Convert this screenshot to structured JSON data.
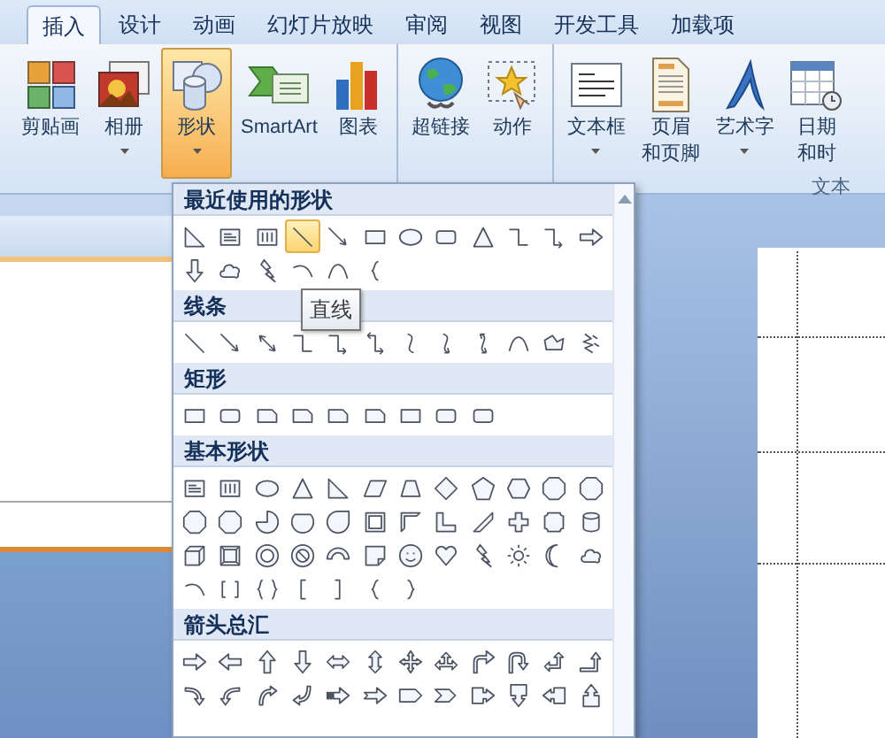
{
  "ribbon_tabs": [
    {
      "label": "插入",
      "selected": true
    },
    {
      "label": "设计",
      "selected": false
    },
    {
      "label": "动画",
      "selected": false
    },
    {
      "label": "幻灯片放映",
      "selected": false
    },
    {
      "label": "审阅",
      "selected": false
    },
    {
      "label": "视图",
      "selected": false
    },
    {
      "label": "开发工具",
      "selected": false
    },
    {
      "label": "加载项",
      "selected": false
    }
  ],
  "ribbon_groups": [
    {
      "buttons": [
        {
          "label": "剪贴画",
          "kind": "clipart",
          "dropdown": false,
          "selected": false
        },
        {
          "label": "相册",
          "kind": "album",
          "dropdown": true,
          "selected": false
        },
        {
          "label": "形状",
          "kind": "shapes",
          "dropdown": true,
          "selected": true
        },
        {
          "label": "SmartArt",
          "kind": "smartart",
          "dropdown": false,
          "selected": false
        },
        {
          "label": "图表",
          "kind": "chart",
          "dropdown": false,
          "selected": false
        }
      ]
    },
    {
      "buttons": [
        {
          "label": "超链接",
          "kind": "hyperlink",
          "dropdown": false,
          "selected": false
        },
        {
          "label": "动作",
          "kind": "action",
          "dropdown": false,
          "selected": false
        }
      ]
    },
    {
      "label": "文本",
      "buttons": [
        {
          "label": "文本框",
          "kind": "textbox",
          "dropdown": true,
          "selected": false
        },
        {
          "label": "页眉",
          "label_2": "和页脚",
          "kind": "header",
          "dropdown": false,
          "selected": false
        },
        {
          "label": "艺术字",
          "kind": "wordart",
          "dropdown": true,
          "selected": false
        },
        {
          "label": "日期",
          "label_2": "和时",
          "kind": "date",
          "dropdown": false,
          "selected": false
        }
      ]
    }
  ],
  "shapes_menu": {
    "sections": [
      {
        "title": "最近使用的形状",
        "shapes": [
          {
            "kind": "right-triangle",
            "selected": false
          },
          {
            "kind": "text-box",
            "selected": false
          },
          {
            "kind": "vertical-text-box",
            "selected": false
          },
          {
            "kind": "line",
            "selected": true
          },
          {
            "kind": "arrow-line",
            "selected": false
          },
          {
            "kind": "rect",
            "selected": false
          },
          {
            "kind": "ellipse",
            "selected": false
          },
          {
            "kind": "rounded-rect",
            "selected": false
          },
          {
            "kind": "triangle",
            "selected": false
          },
          {
            "kind": "elbow",
            "selected": false
          },
          {
            "kind": "elbow-arrow",
            "selected": false
          },
          {
            "kind": "right-arrow",
            "selected": false
          },
          {
            "kind": "down-arrow",
            "selected": false
          },
          {
            "kind": "cloud",
            "selected": false
          },
          {
            "kind": "lightning",
            "selected": false
          },
          {
            "kind": "arc",
            "selected": false
          },
          {
            "kind": "curve",
            "selected": false
          },
          {
            "kind": "brace-left",
            "selected": false
          }
        ]
      },
      {
        "title": "线条",
        "shapes": [
          {
            "kind": "line",
            "selected": false
          },
          {
            "kind": "arrow-line",
            "selected": false
          },
          {
            "kind": "double-arrow-line",
            "selected": false
          },
          {
            "kind": "elbow",
            "selected": false
          },
          {
            "kind": "elbow-arrow",
            "selected": false
          },
          {
            "kind": "elbow-double-arrow",
            "selected": false
          },
          {
            "kind": "curve-s",
            "selected": false
          },
          {
            "kind": "curve-arrow",
            "selected": false
          },
          {
            "kind": "curve-double-arrow",
            "selected": false
          },
          {
            "kind": "curve",
            "selected": false
          },
          {
            "kind": "freeform",
            "selected": false
          },
          {
            "kind": "scribble",
            "selected": false
          }
        ]
      },
      {
        "title": "矩形",
        "shapes": [
          {
            "kind": "rect",
            "selected": false
          },
          {
            "kind": "rounded-rect",
            "selected": false
          },
          {
            "kind": "snip-rect",
            "selected": false
          },
          {
            "kind": "snip-rect",
            "selected": false
          },
          {
            "kind": "snip-rect",
            "selected": false
          },
          {
            "kind": "snip-rect",
            "selected": false
          },
          {
            "kind": "rect",
            "selected": false
          },
          {
            "kind": "rounded-rect",
            "selected": false
          },
          {
            "kind": "rounded-rect",
            "selected": false
          }
        ]
      },
      {
        "title": "基本形状",
        "shapes": [
          {
            "kind": "text-box",
            "selected": false
          },
          {
            "kind": "vertical-text-box",
            "selected": false
          },
          {
            "kind": "ellipse",
            "selected": false
          },
          {
            "kind": "triangle",
            "selected": false
          },
          {
            "kind": "right-triangle",
            "selected": false
          },
          {
            "kind": "parallelogram",
            "selected": false
          },
          {
            "kind": "trapezoid",
            "selected": false
          },
          {
            "kind": "diamond",
            "selected": false
          },
          {
            "kind": "pentagon",
            "selected": false
          },
          {
            "kind": "hexagon",
            "selected": false
          },
          {
            "kind": "octagon",
            "selected": false
          },
          {
            "kind": "octagon",
            "selected": false
          },
          {
            "kind": "octagon",
            "selected": false
          },
          {
            "kind": "octagon",
            "selected": false
          },
          {
            "kind": "pie",
            "selected": false
          },
          {
            "kind": "chord",
            "selected": false
          },
          {
            "kind": "teardrop",
            "selected": false
          },
          {
            "kind": "frame",
            "selected": false
          },
          {
            "kind": "half-frame",
            "selected": false
          },
          {
            "kind": "l-shape",
            "selected": false
          },
          {
            "kind": "diagonal-stripe",
            "selected": false
          },
          {
            "kind": "cross",
            "selected": false
          },
          {
            "kind": "plaque",
            "selected": false
          },
          {
            "kind": "cylinder",
            "selected": false
          },
          {
            "kind": "cube",
            "selected": false
          },
          {
            "kind": "bevel",
            "selected": false
          },
          {
            "kind": "donut",
            "selected": false
          },
          {
            "kind": "no-symbol",
            "selected": false
          },
          {
            "kind": "block-arc",
            "selected": false
          },
          {
            "kind": "folded-corner",
            "selected": false
          },
          {
            "kind": "smiley",
            "selected": false
          },
          {
            "kind": "heart",
            "selected": false
          },
          {
            "kind": "lightning",
            "selected": false
          },
          {
            "kind": "sun",
            "selected": false
          },
          {
            "kind": "moon",
            "selected": false
          },
          {
            "kind": "cloud",
            "selected": false
          },
          {
            "kind": "arc",
            "selected": false
          },
          {
            "kind": "double-bracket",
            "selected": false
          },
          {
            "kind": "double-brace",
            "selected": false
          },
          {
            "kind": "bracket-left",
            "selected": false
          },
          {
            "kind": "bracket-right",
            "selected": false
          },
          {
            "kind": "brace-left",
            "selected": false
          },
          {
            "kind": "brace-right",
            "selected": false
          }
        ]
      },
      {
        "title": "箭头总汇",
        "shapes": [
          {
            "kind": "right-arrow",
            "selected": false
          },
          {
            "kind": "left-arrow",
            "selected": false
          },
          {
            "kind": "up-arrow",
            "selected": false
          },
          {
            "kind": "down-arrow",
            "selected": false
          },
          {
            "kind": "left-right-arrow",
            "selected": false
          },
          {
            "kind": "up-down-arrow",
            "selected": false
          },
          {
            "kind": "quad-arrow",
            "selected": false
          },
          {
            "kind": "left-right-up-arrow",
            "selected": false
          },
          {
            "kind": "bent-arrow",
            "selected": false
          },
          {
            "kind": "u-turn-arrow",
            "selected": false
          },
          {
            "kind": "left-up-arrow",
            "selected": false
          },
          {
            "kind": "bent-up-arrow",
            "selected": false
          },
          {
            "kind": "curved-right-arrow",
            "selected": false
          },
          {
            "kind": "curved-left-arrow",
            "selected": false
          },
          {
            "kind": "curved-up-arrow",
            "selected": false
          },
          {
            "kind": "curved-down-arrow",
            "selected": false
          },
          {
            "kind": "striped-right-arrow",
            "selected": false
          },
          {
            "kind": "notched-right-arrow",
            "selected": false
          },
          {
            "kind": "pentagon-arrow",
            "selected": false
          },
          {
            "kind": "chevron",
            "selected": false
          },
          {
            "kind": "right-arrow-callout",
            "selected": false
          },
          {
            "kind": "down-arrow-callout",
            "selected": false
          },
          {
            "kind": "left-arrow-callout",
            "selected": false
          },
          {
            "kind": "up-arrow-callout",
            "selected": false
          }
        ]
      }
    ],
    "tooltip": "直线"
  }
}
